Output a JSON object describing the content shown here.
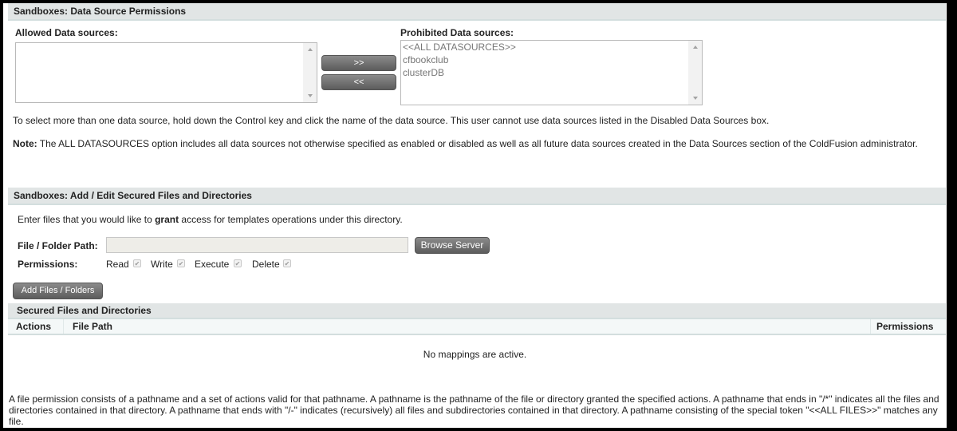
{
  "datasource_section": {
    "title": "Sandboxes: Data Source Permissions",
    "allowed_label": "Allowed Data sources:",
    "allowed_options": [],
    "prohibited_label": "Prohibited Data sources:",
    "prohibited_options": [
      "<<ALL DATASOURCES>>",
      "cfbookclub",
      "clusterDB"
    ],
    "move_right_label": ">>",
    "move_left_label": "<<",
    "help_text": "To select more than one data source, hold down the Control key and click the name of the data source. This user cannot use data sources listed in the Disabled Data Sources box.",
    "note_label": "Note:",
    "note_text": " The ALL DATASOURCES option includes all data sources not otherwise specified as enabled or disabled as well as all future data sources created in the Data Sources section of the ColdFusion administrator."
  },
  "files_section": {
    "title": "Sandboxes: Add / Edit Secured Files and Directories",
    "intro_before": "Enter files that you would like to ",
    "intro_bold": "grant",
    "intro_after": " access for templates operations under this directory.",
    "path_label": "File / Folder Path:",
    "path_value": "",
    "browse_label": "Browse Server",
    "permissions_label": "Permissions:",
    "permissions": [
      {
        "label": "Read",
        "checked": true
      },
      {
        "label": "Write",
        "checked": true
      },
      {
        "label": "Execute",
        "checked": true
      },
      {
        "label": "Delete",
        "checked": true
      }
    ],
    "add_label": "Add Files / Folders"
  },
  "secured_table": {
    "title": "Secured Files and Directories",
    "columns": [
      "Actions",
      "File Path",
      "Permissions"
    ],
    "rows": [],
    "empty_text": "No mappings are active."
  },
  "footer_text": "A file permission consists of a pathname and a set of actions valid for that pathname. A pathname is the pathname of the file or directory granted the specified actions. A pathname that ends in \"/*\" indicates all the files and directories contained in that directory. A pathname that ends with \"/-\" indicates (recursively) all files and subdirectories contained in that directory. A pathname consisting of the special token \"<<ALL FILES>>\" matches any file."
}
